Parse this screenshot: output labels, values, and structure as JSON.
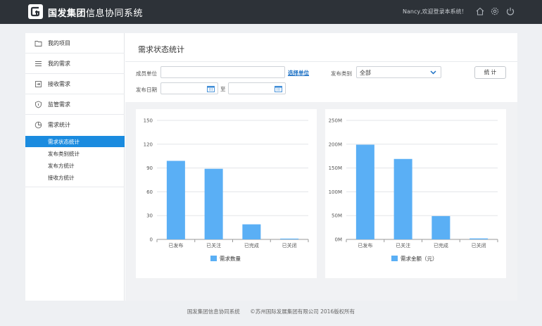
{
  "header": {
    "title_bold": "国发集团",
    "title_rest": "信息协同系统",
    "welcome": "Nancy,欢迎登录本系统！",
    "icons": [
      "home-icon",
      "settings-icon",
      "power-icon"
    ]
  },
  "sidebar": {
    "items": [
      {
        "label": "我的项目",
        "icon": "folder-icon"
      },
      {
        "label": "我的需求",
        "icon": "list-icon"
      },
      {
        "label": "接收需求",
        "icon": "inbox-icon"
      },
      {
        "label": "监管需求",
        "icon": "shield-icon"
      },
      {
        "label": "需求统计",
        "icon": "pie-chart-icon"
      }
    ],
    "sub_items": [
      {
        "label": "需求状态统计",
        "active": true
      },
      {
        "label": "发布类别统计",
        "active": false
      },
      {
        "label": "发布方统计",
        "active": false
      },
      {
        "label": "接收方统计",
        "active": false
      }
    ]
  },
  "main": {
    "page_title": "需求状态统计",
    "filters": {
      "member_unit_label": "成员单位",
      "member_unit_value": "",
      "select_unit_link": "选择单位",
      "category_label": "发布类别",
      "category_value": "全部",
      "date_label": "发布日期",
      "date_from": "",
      "date_to_label": "至",
      "date_to": "",
      "stat_button": "统 计"
    }
  },
  "colors": {
    "accent": "#1a8bdf",
    "bar": "#5aaff5",
    "topbar": "#2d3238"
  },
  "chart_data": [
    {
      "type": "bar",
      "categories": [
        "已发布",
        "已关注",
        "已完成",
        "已关闭"
      ],
      "series": [
        {
          "name": "需求数量",
          "values": [
            99,
            89,
            19,
            1
          ]
        }
      ],
      "yticks": [
        "0",
        "30",
        "60",
        "90",
        "120",
        "150"
      ],
      "ylim": [
        0,
        150
      ],
      "grid": true,
      "legend": "bottom"
    },
    {
      "type": "bar",
      "categories": [
        "已发布",
        "已关注",
        "已完成",
        "已关闭"
      ],
      "series": [
        {
          "name": "需求金额（元）",
          "values": [
            199,
            169,
            49,
            2
          ]
        }
      ],
      "yticks": [
        "0M",
        "50M",
        "100M",
        "150M",
        "200M",
        "250M"
      ],
      "ylim": [
        0,
        250
      ],
      "grid": true,
      "legend": "bottom"
    }
  ],
  "footer": {
    "system_name": "国发集团信息协同系统",
    "copyright": "©苏州国际发展集团有限公司 2016版权所有"
  }
}
